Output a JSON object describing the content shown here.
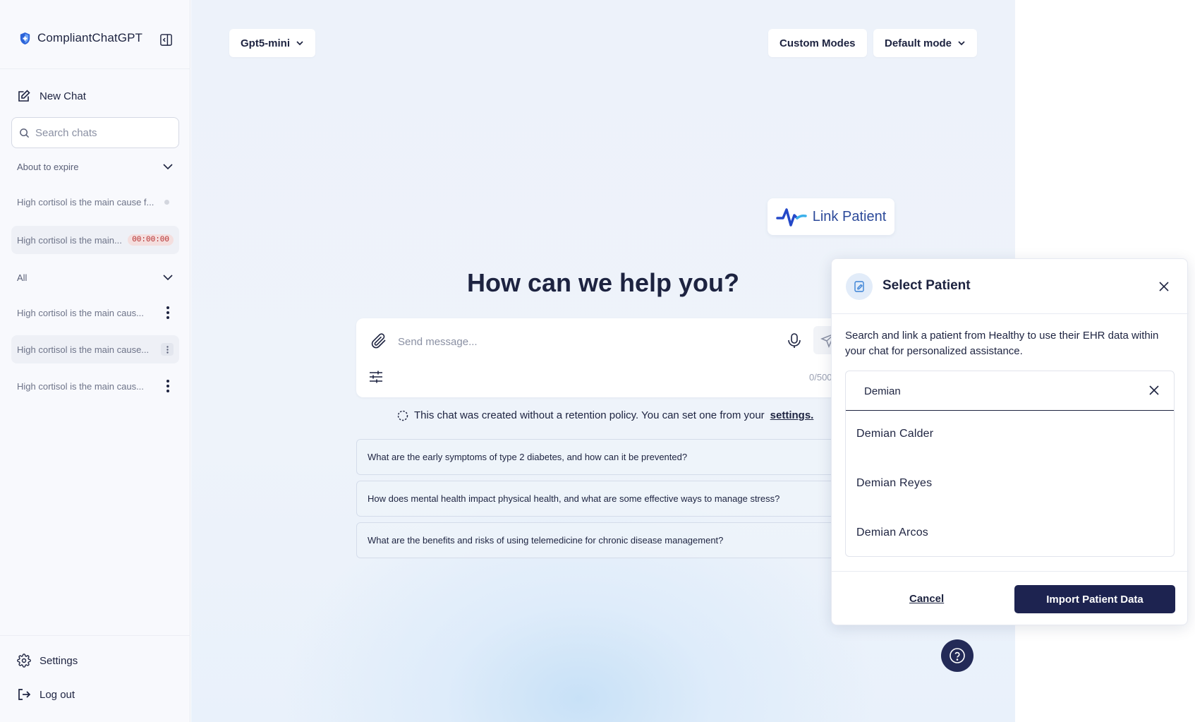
{
  "app": {
    "name": "CompliantChatGPT"
  },
  "sidebar": {
    "new_chat_label": "New Chat",
    "search_placeholder": "Search chats",
    "sections": [
      {
        "title": "About to expire",
        "items": [
          {
            "title": "High cortisol is the main cause f...",
            "indicator": "dot"
          },
          {
            "title": "High cortisol is the main...",
            "timer": "00:00:00"
          }
        ]
      },
      {
        "title": "All",
        "items": [
          {
            "title": "High cortisol is the main caus..."
          },
          {
            "title": "High cortisol is the main cause..."
          },
          {
            "title": "High cortisol is the main caus..."
          }
        ]
      }
    ],
    "settings_label": "Settings",
    "logout_label": "Log out"
  },
  "header": {
    "model_selector": "Gpt5-mini",
    "custom_modes_label": "Custom Modes",
    "mode_selector": "Default mode"
  },
  "main": {
    "link_patient_label": "Link Patient",
    "hero_title": "How can we help you?",
    "composer": {
      "placeholder": "Send message...",
      "counter": "0/500"
    },
    "retention_notice": "This chat was created without a retention policy. You can set one from your",
    "retention_link": "settings.",
    "suggestions": [
      "What are the early symptoms of type 2 diabetes, and how can it be prevented?",
      "How does mental health impact physical health, and what are some effective ways to manage stress?",
      "What are the benefits and risks of using telemedicine for chronic disease management?"
    ]
  },
  "modal": {
    "title": "Select Patient",
    "description": "Search and link a patient from Healthy to use their EHR data within your chat for personalized assistance.",
    "search_value": "Demian",
    "patients": [
      "Demian Calder",
      "Demian Reyes",
      "Demian Arcos"
    ],
    "cancel_label": "Cancel",
    "import_label": "Import Patient Data"
  },
  "colors": {
    "primary_dark": "#1d2350",
    "timer_red": "#b32626",
    "link_patient_blue": "#2c4a9a"
  }
}
